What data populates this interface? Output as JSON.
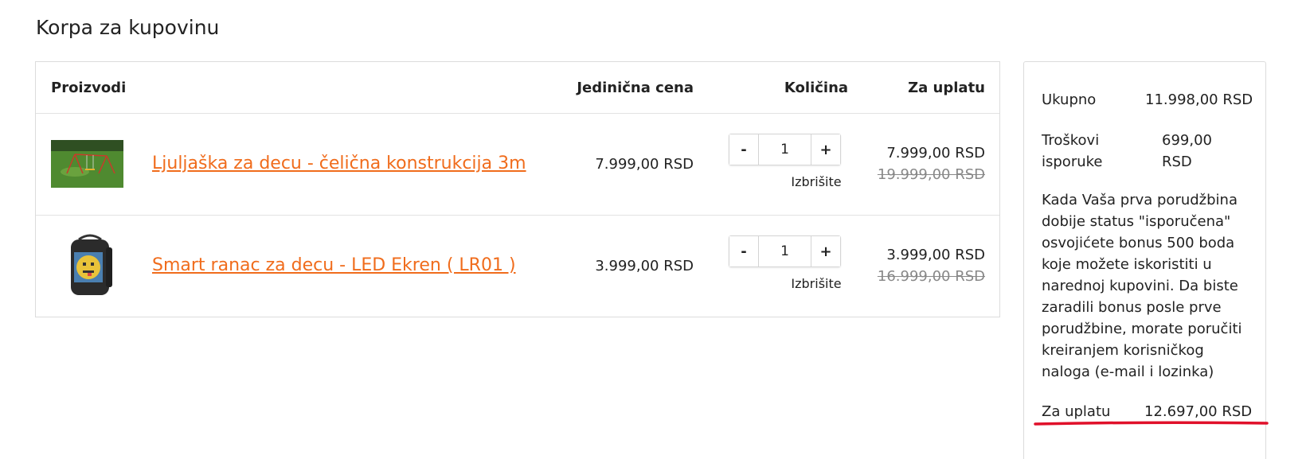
{
  "page": {
    "title": "Korpa za kupovinu"
  },
  "table": {
    "headers": {
      "products": "Proizvodi",
      "unit_price": "Jedinična cena",
      "quantity": "Količina",
      "total": "Za uplatu"
    },
    "items": [
      {
        "name": "Ljuljaška za decu - čelična konstrukcija 3m",
        "unit_price": "7.999,00  RSD",
        "quantity": "1",
        "remove_label": "Izbrišite",
        "total": "7.999,00  RSD",
        "old_price": "19.999,00  RSD"
      },
      {
        "name": "Smart ranac za decu - LED Ekren ( LR01 )",
        "unit_price": "3.999,00  RSD",
        "quantity": "1",
        "remove_label": "Izbrišite",
        "total": "3.999,00  RSD",
        "old_price": "16.999,00  RSD"
      }
    ],
    "qty_minus": "-",
    "qty_plus": "+"
  },
  "summary": {
    "subtotal_label": "Ukupno",
    "subtotal_value": "11.998,00  RSD",
    "shipping_label_1": "Troškovi",
    "shipping_label_2": "isporuke",
    "shipping_value_1": "699,00",
    "shipping_value_2": "RSD",
    "bonus_text": "Kada Vaša prva porudžbina dobije status \"isporučena\" osvojićete bonus 500 boda koje možete iskoristiti u narednoj kupovini. Da biste zaradili bonus posle prve porudžbine, morate poručiti kreiranjem korisničkog naloga (e-mail i lozinka)",
    "total_label": "Za uplatu",
    "total_value": "12.697,00  RSD"
  },
  "colors": {
    "link": "#f06c1c",
    "annotation_underline": "#e0102a"
  },
  "icons": [
    "swing-product-thumbnail",
    "led-backpack-product-thumbnail"
  ]
}
